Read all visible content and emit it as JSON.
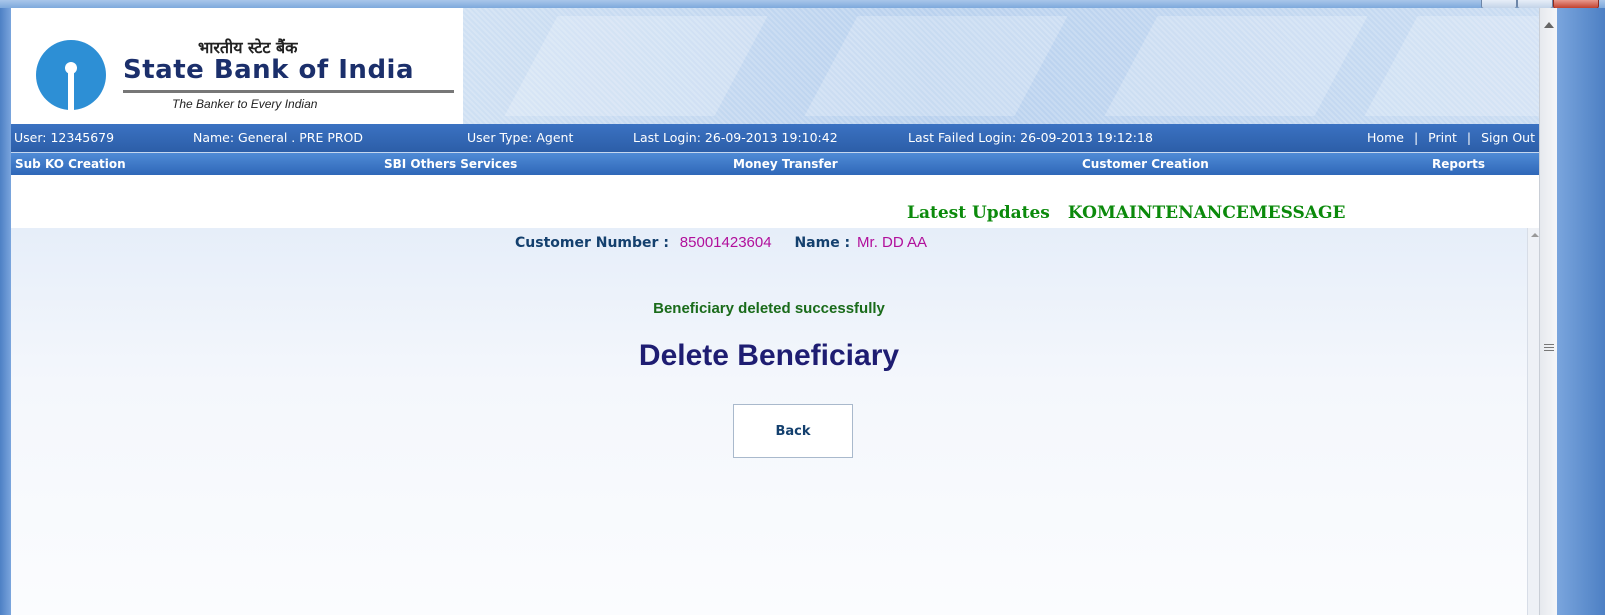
{
  "header": {
    "hindi_title": "भारतीय स्टेट बैंक",
    "bank_name": "State Bank of India",
    "tagline": "The Banker to Every Indian"
  },
  "info_bar": {
    "user": "User: 12345679",
    "name": "Name: General . PRE PROD",
    "user_type": "User Type: Agent",
    "last_login": "Last Login: 26-09-2013 19:10:42",
    "last_failed_login": "Last Failed Login: 26-09-2013 19:12:18",
    "links": {
      "home": "Home",
      "separator": "|",
      "print": "Print",
      "sign_out": "Sign Out"
    }
  },
  "menu": {
    "items": [
      "Sub KO Creation",
      "SBI Others Services",
      "Money Transfer",
      "Customer Creation",
      "Reports"
    ]
  },
  "updates": {
    "label": "Latest Updates",
    "message": "KOMAINTENANCEMESSAGE"
  },
  "customer": {
    "number_label": "Customer Number :",
    "number_value": "85001423604",
    "name_label": "Name :",
    "name_value": "Mr. DD AA"
  },
  "main": {
    "success_message": "Beneficiary deleted successfully",
    "title": "Delete Beneficiary",
    "back_label": "Back"
  },
  "colors": {
    "brand_blue": "#2d8fd5",
    "nav_blue": "#2f67b8",
    "success_green": "#1a6b1a",
    "title_navy": "#1e1d72",
    "value_magenta": "#b10f9b"
  }
}
